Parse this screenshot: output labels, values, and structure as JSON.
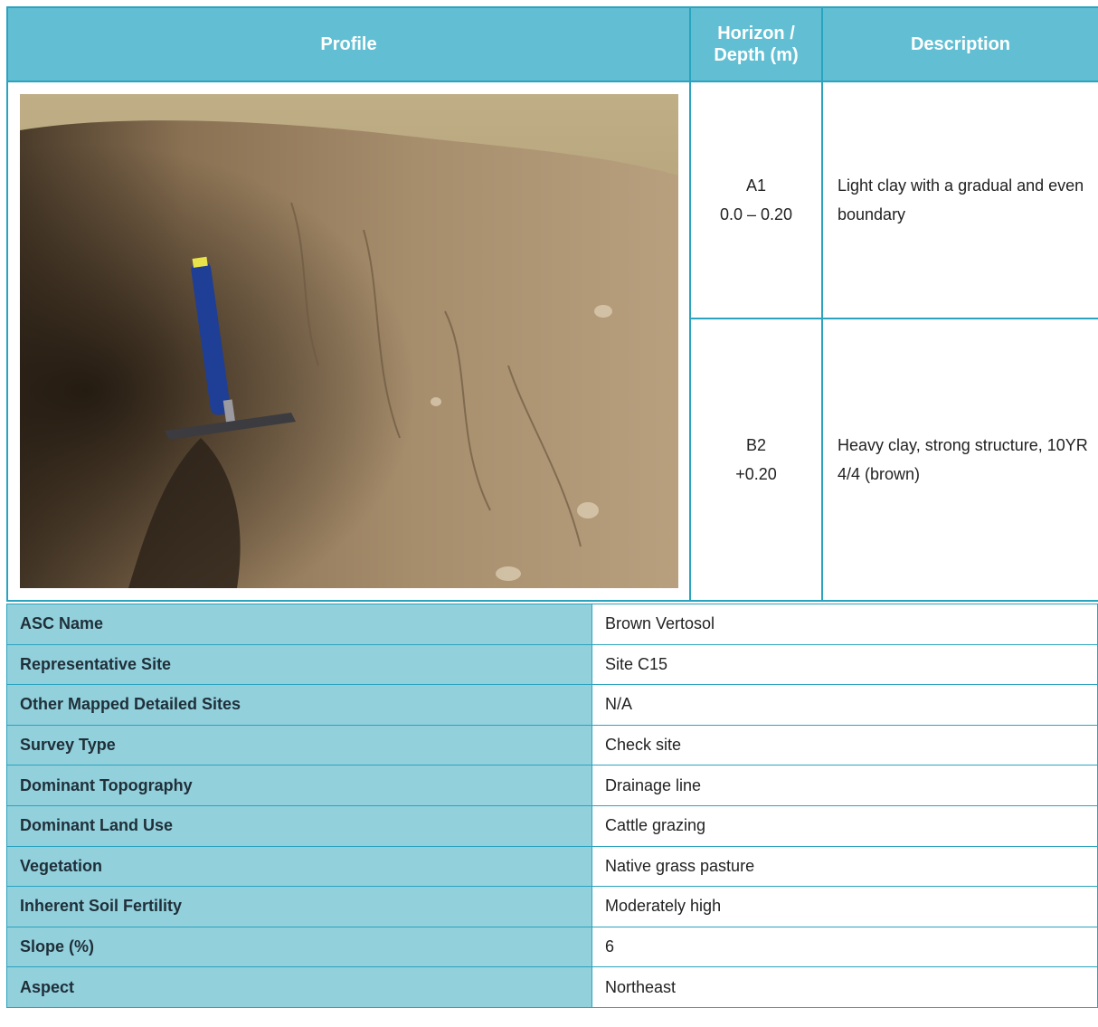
{
  "header": {
    "profile": "Profile",
    "horizon_line1": "Horizon /",
    "horizon_line2": "Depth (m)",
    "description": "Description"
  },
  "horizons": [
    {
      "name": "A1",
      "depth": "0.0 – 0.20",
      "description": "Light clay with a gradual and even boundary"
    },
    {
      "name": "B2",
      "depth": "+0.20",
      "description": "Heavy clay, strong structure, 10YR 4/4 (brown)"
    }
  ],
  "info": [
    {
      "label": "ASC Name",
      "value": "Brown Vertosol"
    },
    {
      "label": "Representative Site",
      "value": "Site C15"
    },
    {
      "label": "Other Mapped Detailed Sites",
      "value": "N/A"
    },
    {
      "label": "Survey Type",
      "value": "Check site"
    },
    {
      "label": "Dominant Topography",
      "value": "Drainage line"
    },
    {
      "label": "Dominant Land Use",
      "value": "Cattle grazing"
    },
    {
      "label": "Vegetation",
      "value": "Native grass pasture"
    },
    {
      "label": "Inherent Soil Fertility",
      "value": "Moderately high"
    },
    {
      "label": "Slope (%)",
      "value": "6"
    },
    {
      "label": "Aspect",
      "value": "Northeast"
    }
  ],
  "colors": {
    "header_bg": "#62bfd3",
    "border": "#2aa3bf",
    "label_bg": "#92d0dc"
  }
}
